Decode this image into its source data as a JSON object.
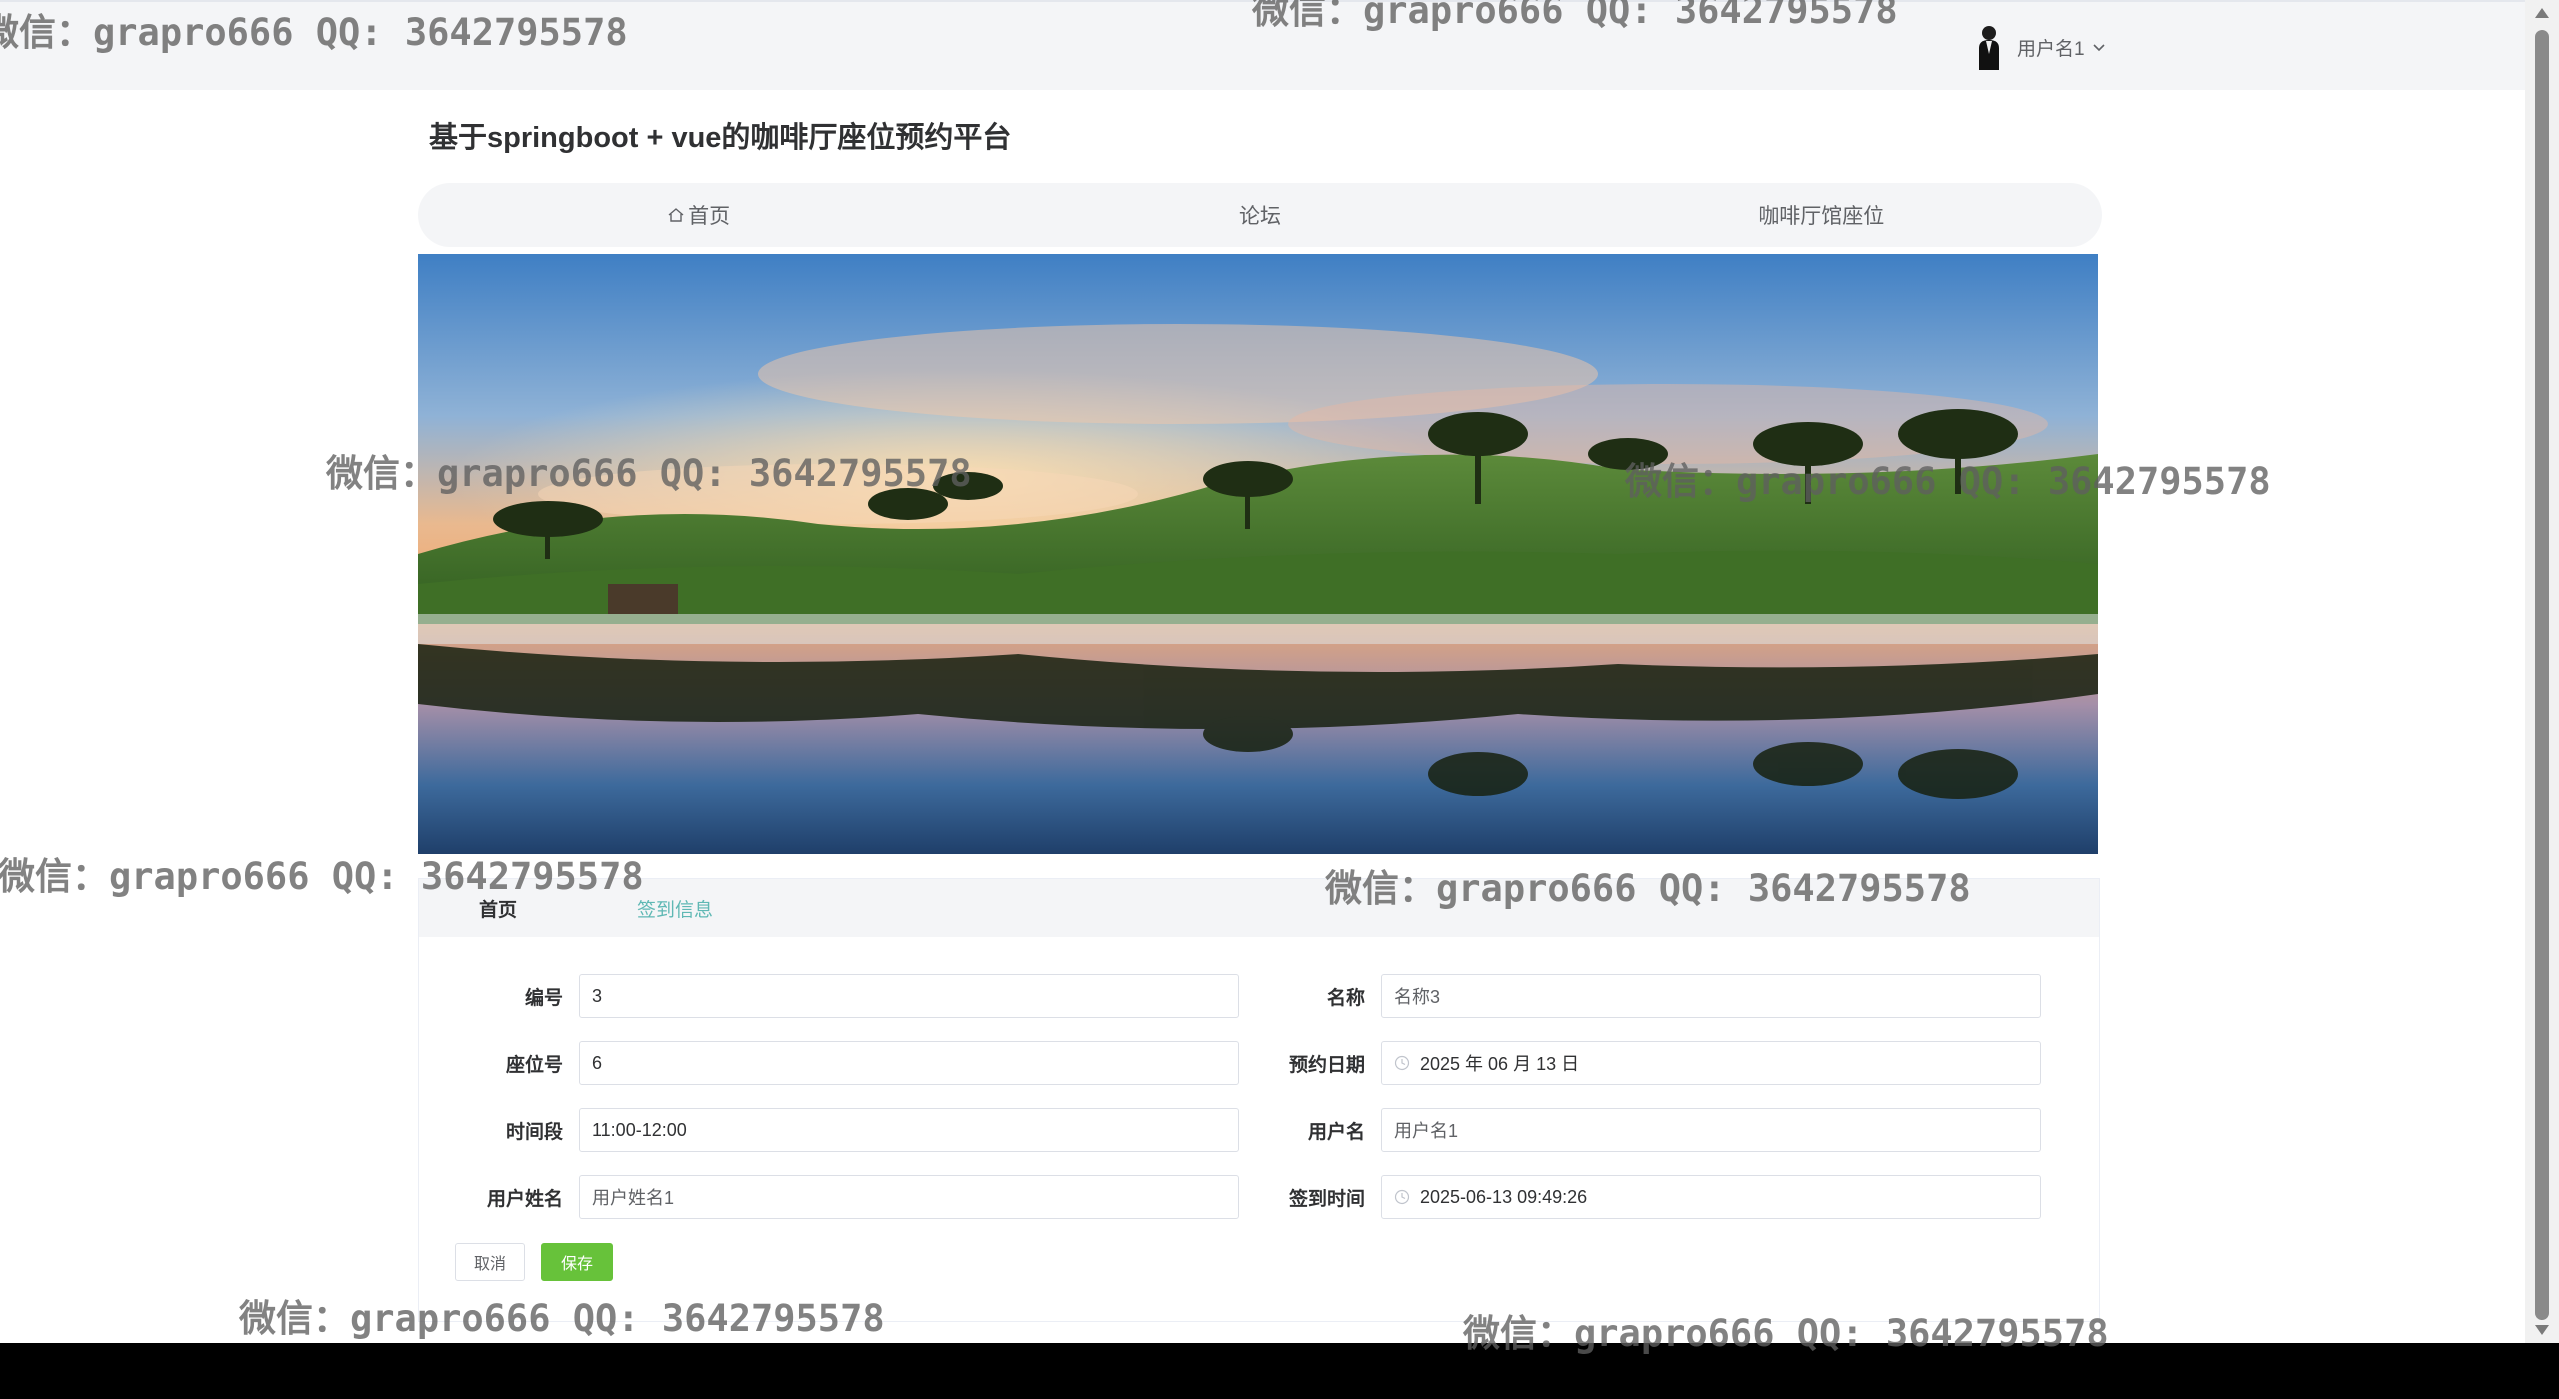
{
  "header": {
    "username": "用户名1"
  },
  "site": {
    "title": "基于springboot + vue的咖啡厅座位预约平台"
  },
  "nav": {
    "items": [
      {
        "label": "首页",
        "icon": "home-icon"
      },
      {
        "label": "论坛"
      },
      {
        "label": "咖啡厅馆座位"
      }
    ]
  },
  "breadcrumb": {
    "home": "首页",
    "current": "签到信息"
  },
  "form": {
    "fields": {
      "bianhao": {
        "label": "编号",
        "value": "3"
      },
      "mingcheng": {
        "label": "名称",
        "value": "名称3"
      },
      "zuoweihao": {
        "label": "座位号",
        "value": "6"
      },
      "yuyueriqi": {
        "label": "预约日期",
        "value": "2025 年 06 月 13 日"
      },
      "shijianduan": {
        "label": "时间段",
        "value": "11:00-12:00"
      },
      "yonghuming": {
        "label": "用户名",
        "value": "用户名1"
      },
      "yonghuxingming": {
        "label": "用户姓名",
        "value": "用户姓名1"
      },
      "qiandaoshijian": {
        "label": "签到时间",
        "value": "2025-06-13 09:49:26"
      }
    },
    "buttons": {
      "cancel": "取消",
      "save": "保存"
    }
  },
  "watermark": "微信：grapro666 QQ: 3642795578",
  "colors": {
    "accent_link": "#5fb8b4",
    "save_button": "#67c23a",
    "nav_bg": "#f4f5f7"
  }
}
